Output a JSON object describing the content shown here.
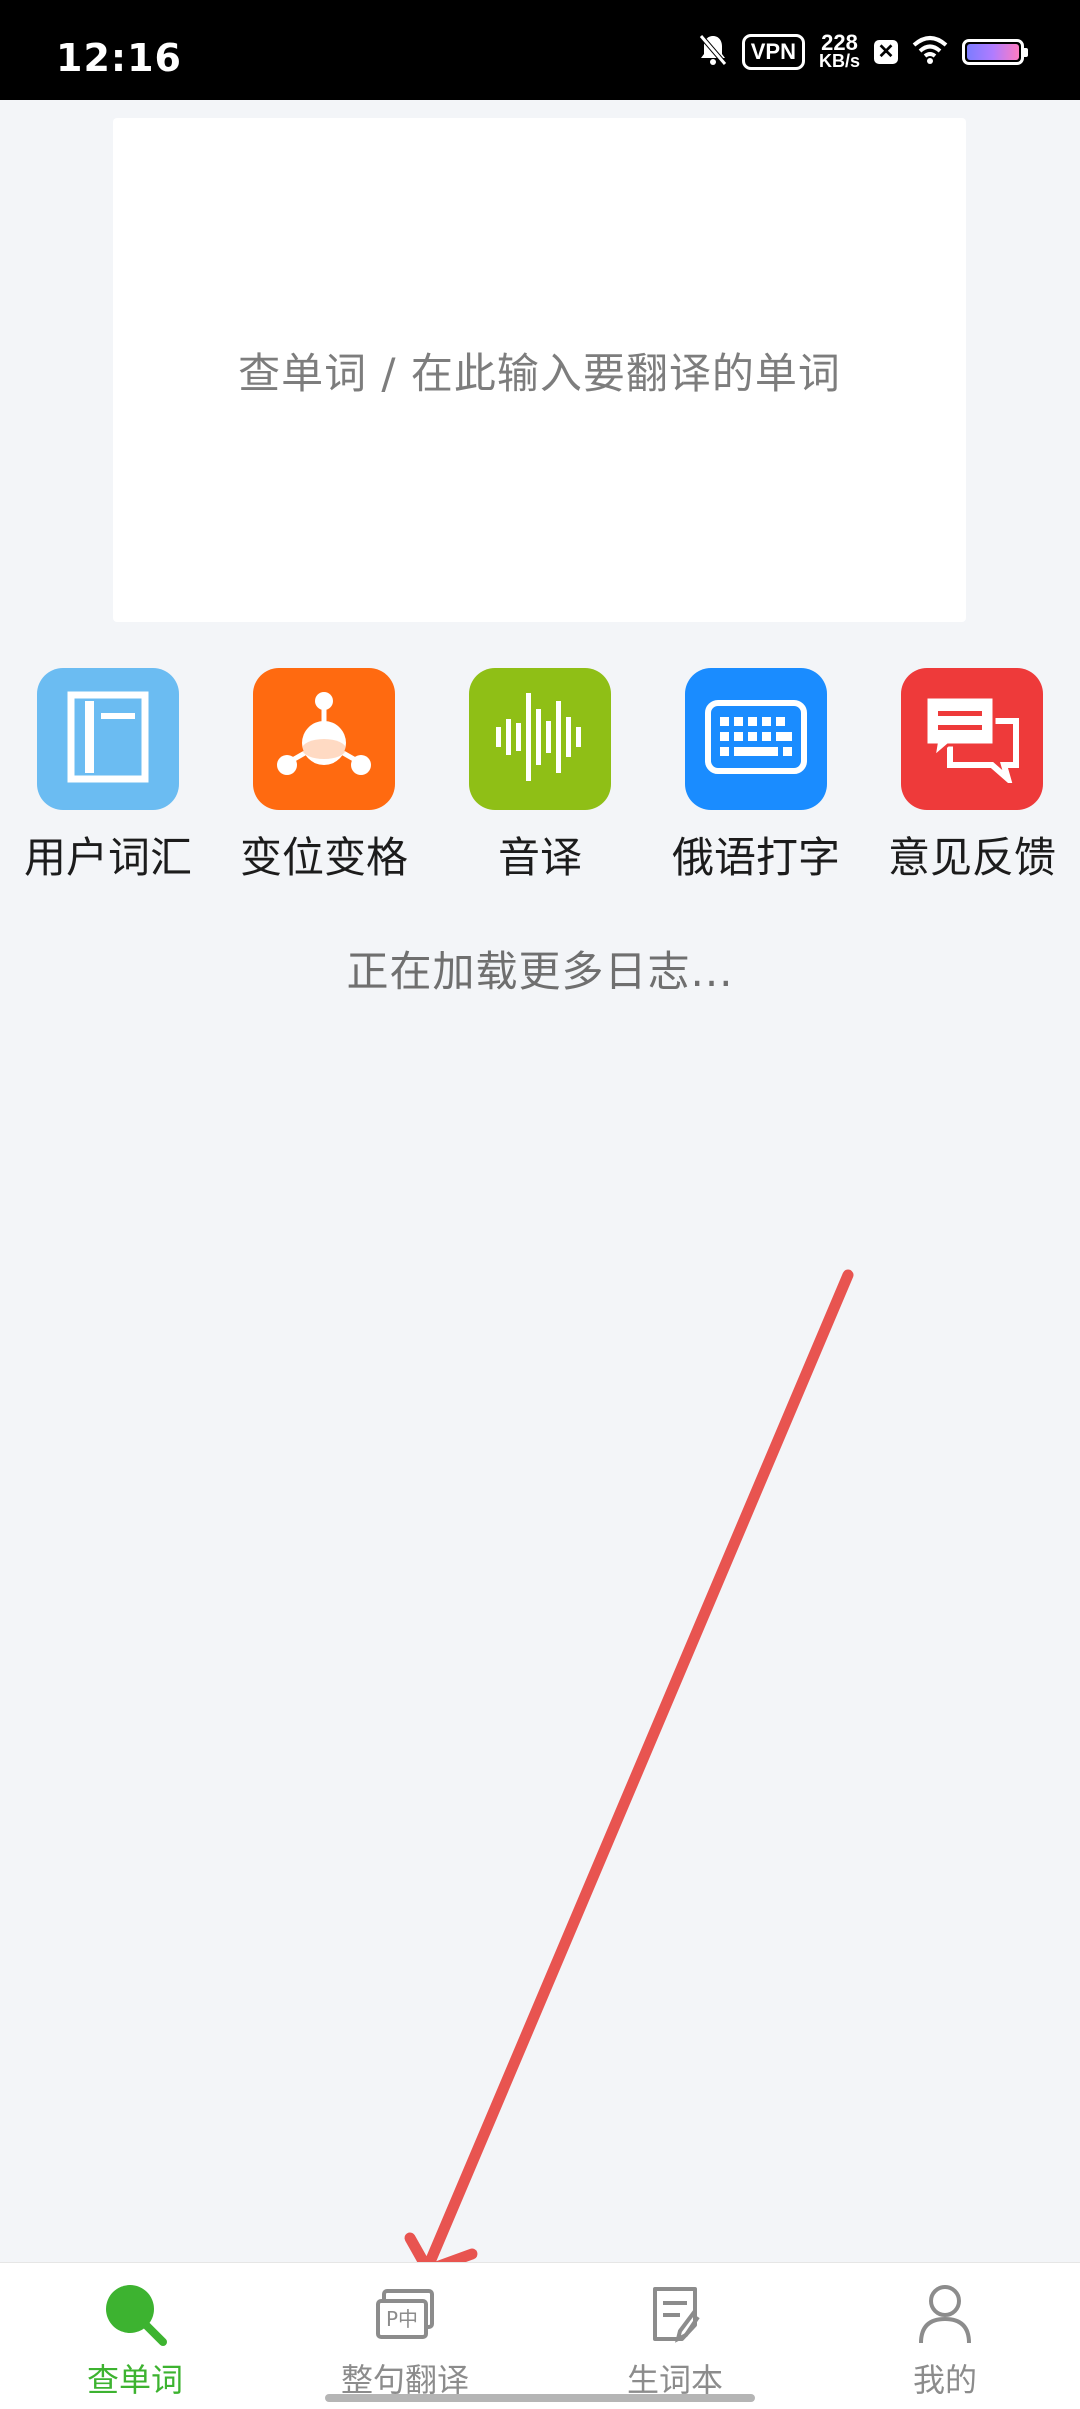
{
  "status_bar": {
    "time": "12:16",
    "vpn_label": "VPN",
    "speed_value": "228",
    "speed_unit": "KB/s",
    "icons": [
      "mute-bell-icon",
      "vpn-icon",
      "network-speed",
      "x-app-icon",
      "wifi-icon",
      "battery-icon"
    ]
  },
  "search": {
    "placeholder": "查单词 / 在此输入要翻译的单词"
  },
  "features": [
    {
      "label": "用户词汇",
      "icon": "notebook-icon",
      "color": "#6bbcf2"
    },
    {
      "label": "变位变格",
      "icon": "molecule-icon",
      "color": "#ff6a10"
    },
    {
      "label": "音译",
      "icon": "sound-wave-icon",
      "color": "#8fbf16"
    },
    {
      "label": "俄语打字",
      "icon": "keyboard-icon",
      "color": "#1a8cff"
    },
    {
      "label": "意见反馈",
      "icon": "chat-bubbles-icon",
      "color": "#ee3a3a"
    }
  ],
  "loading_text": "正在加载更多日志...",
  "bottom_nav": {
    "active_color": "#3db330",
    "items": [
      {
        "label": "查单词",
        "icon": "search-icon",
        "active": true
      },
      {
        "label": "整句翻译",
        "icon": "sentence-translate-icon",
        "active": false
      },
      {
        "label": "生词本",
        "icon": "vocabulary-book-icon",
        "active": false
      },
      {
        "label": "我的",
        "icon": "profile-icon",
        "active": false
      }
    ]
  },
  "annotation": {
    "arrow_color": "#e85450",
    "icon": "pointer-arrow-icon"
  }
}
